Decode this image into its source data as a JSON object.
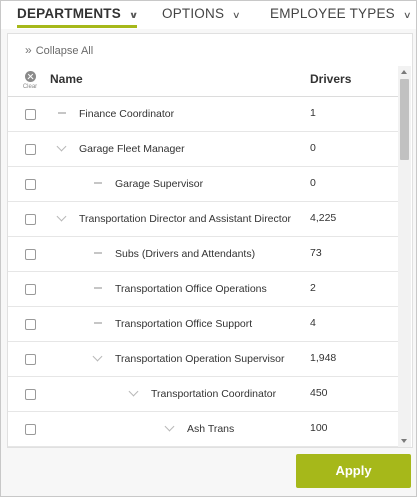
{
  "tabs": [
    {
      "label": "DEPARTMENTS",
      "active": true
    },
    {
      "label": "OPTIONS",
      "active": false
    },
    {
      "label": "EMPLOYEE TYPES",
      "active": false
    }
  ],
  "toolbar": {
    "collapse_all_label": "Collapse All"
  },
  "table": {
    "clear_label": "Clear",
    "columns": {
      "name": "Name",
      "drivers": "Drivers"
    },
    "rows": [
      {
        "name": "Finance Coordinator",
        "drivers": "1",
        "level": 0,
        "toggle": "leaf"
      },
      {
        "name": "Garage Fleet Manager",
        "drivers": "0",
        "level": 0,
        "toggle": "expanded"
      },
      {
        "name": "Garage Supervisor",
        "drivers": "0",
        "level": 1,
        "toggle": "leaf"
      },
      {
        "name": "Transportation Director and Assistant Director",
        "drivers": "4,225",
        "level": 0,
        "toggle": "expanded"
      },
      {
        "name": "Subs (Drivers and Attendants)",
        "drivers": "73",
        "level": 1,
        "toggle": "leaf"
      },
      {
        "name": "Transportation Office Operations",
        "drivers": "2",
        "level": 1,
        "toggle": "leaf"
      },
      {
        "name": "Transportation Office Support",
        "drivers": "4",
        "level": 1,
        "toggle": "leaf"
      },
      {
        "name": "Transportation Operation Supervisor",
        "drivers": "1,948",
        "level": 1,
        "toggle": "expanded"
      },
      {
        "name": "Transportation Coordinator",
        "drivers": "450",
        "level": 2,
        "toggle": "expanded"
      },
      {
        "name": "Ash Trans",
        "drivers": "100",
        "level": 3,
        "toggle": "expanded"
      }
    ]
  },
  "footer": {
    "apply_label": "Apply"
  },
  "colors": {
    "accent": "#a6b81a",
    "text": "#333333",
    "border": "#c8c8c8"
  }
}
